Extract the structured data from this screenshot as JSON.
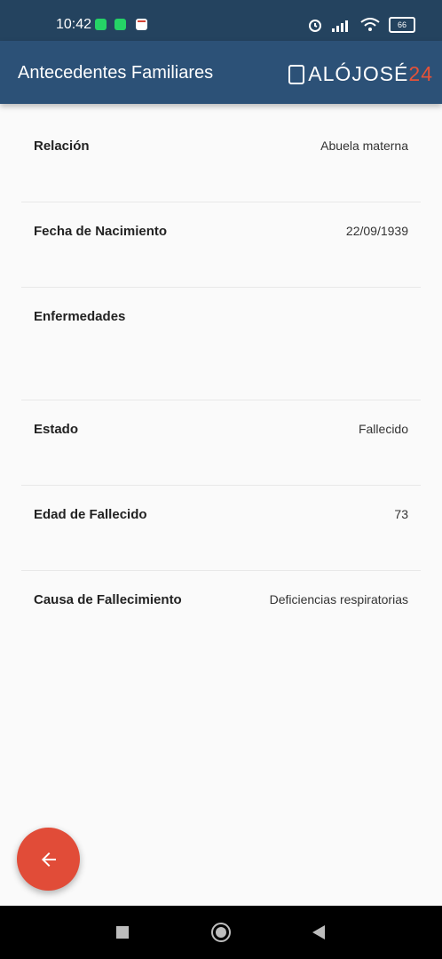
{
  "status_bar": {
    "time": "10:42",
    "battery": "66"
  },
  "app_bar": {
    "title": "Antecedentes Familiares",
    "brand": {
      "text": "ALÓJOSÉ",
      "number": "24"
    }
  },
  "details": [
    {
      "label": "Relación",
      "value": "Abuela materna"
    },
    {
      "label": "Fecha de Nacimiento",
      "value": "22/09/1939"
    },
    {
      "label": "Enfermedades",
      "value": ""
    },
    {
      "label": "Estado",
      "value": "Fallecido"
    },
    {
      "label": "Edad de Fallecido",
      "value": "73"
    },
    {
      "label": "Causa de Fallecimiento",
      "value": "Deficiencias respiratorias"
    }
  ],
  "colors": {
    "app_bar": "#2c5177",
    "status_bar": "#24435f",
    "fab": "#e14c38",
    "background": "#fafafa"
  },
  "icons": {
    "fab": "arrow-back-icon"
  }
}
